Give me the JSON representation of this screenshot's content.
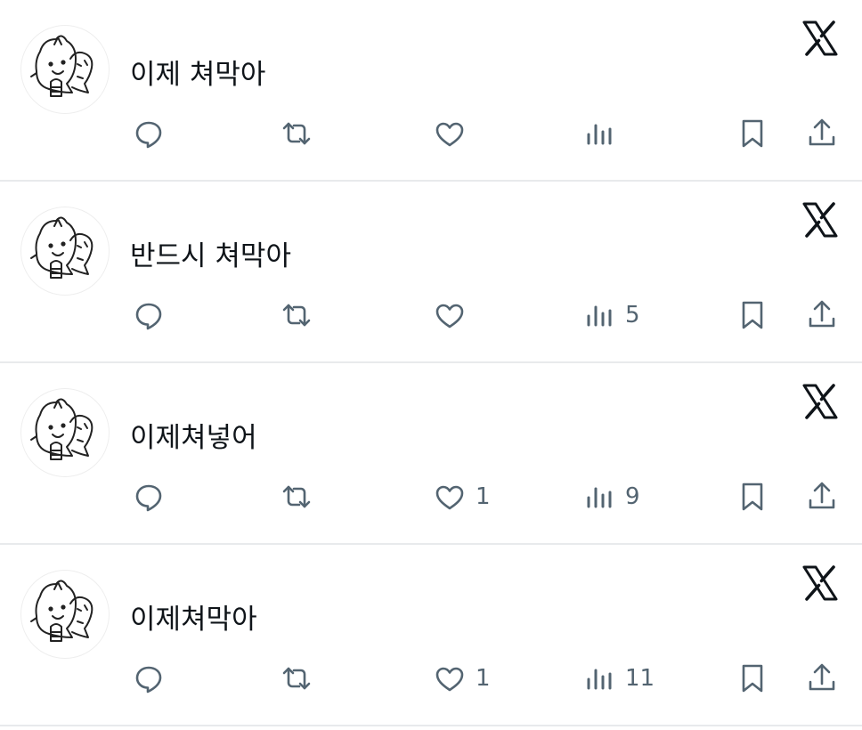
{
  "posts": [
    {
      "text": "이제 쳐막아",
      "like_count": "",
      "view_count": ""
    },
    {
      "text": "반드시 쳐막아",
      "like_count": "",
      "view_count": "5"
    },
    {
      "text": "이제쳐넣어",
      "like_count": "1",
      "view_count": "9"
    },
    {
      "text": "이제쳐막아",
      "like_count": "1",
      "view_count": "11"
    }
  ],
  "icons": {
    "brand": "x-logo-icon",
    "reply": "reply-icon",
    "repost": "repost-icon",
    "like": "heart-icon",
    "views": "views-icon",
    "bookmark": "bookmark-icon",
    "share": "share-icon"
  },
  "colors": {
    "text": "#0f1419",
    "icon": "#536471",
    "divider": "#e8eaec"
  }
}
